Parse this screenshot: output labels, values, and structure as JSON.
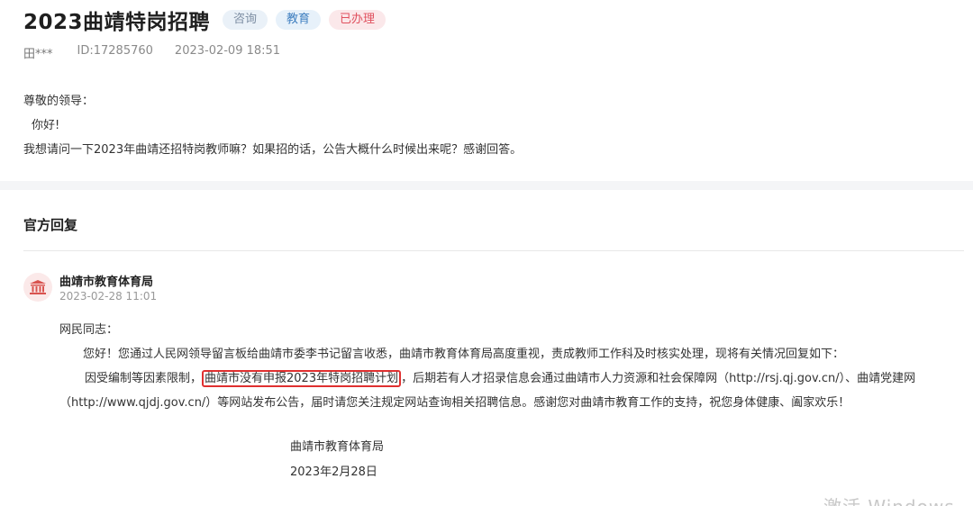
{
  "question": {
    "title": "2023曲靖特岗招聘",
    "tags": [
      "咨询",
      "教育",
      "已办理"
    ],
    "author": "田***",
    "id_text": "ID:17285760",
    "datetime": "2023-02-09 18:51",
    "body": {
      "salutation": "尊敬的领导：",
      "greeting": "你好!",
      "content": "我想请问一下2023年曲靖还招特岗教师嘛？如果招的话，公告大概什么时候出来呢？感谢回答。"
    }
  },
  "reply": {
    "section_title": "官方回复",
    "org_name": "曲靖市教育体育局",
    "datetime": "2023-02-28 11:01",
    "salutation": "网民同志：",
    "para1": "您好！您通过人民网领导留言板给曲靖市委李书记留言收悉，曲靖市教育体育局高度重视，责成教师工作科及时核实处理，现将有关情况回复如下：",
    "para2_before": "因受编制等因素限制，",
    "para2_highlight": "曲靖市没有申报2023年特岗招聘计划",
    "para2_after": "，后期若有人才招录信息会通过曲靖市人力资源和社会保障网（http://rsj.qj.gov.cn/）、曲靖党建网（http://www.qjdj.gov.cn/）等网站发布公告，届时请您关注规定网站查询相关招聘信息。感谢您对曲靖市教育工作的支持，祝您身体健康、阖家欢乐！",
    "signature_org": "曲靖市教育体育局",
    "signature_date": "2023年2月28日"
  },
  "watermark": "激活 Windows",
  "colors": {
    "tag_consult_bg": "#eaf1f8",
    "tag_education": "#3f7fc0",
    "tag_done": "#e0505e",
    "highlight_box": "#e03030",
    "avatar_bg": "#fbe9e9",
    "avatar_icon": "#d9534f"
  },
  "icons": {
    "org_avatar": "government-building-icon"
  }
}
